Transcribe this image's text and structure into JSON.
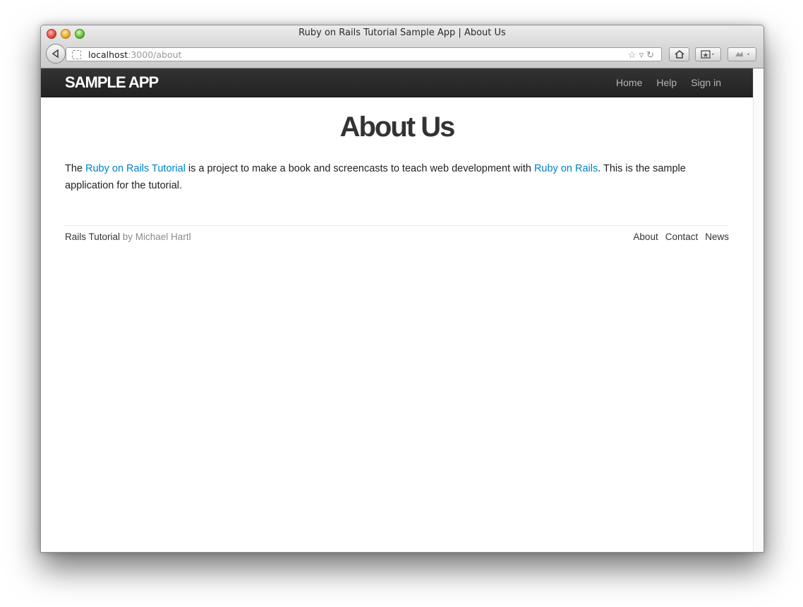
{
  "window": {
    "title": "Ruby on Rails Tutorial Sample App | About Us"
  },
  "address_bar": {
    "host": "localhost",
    "rest": ":3000/about"
  },
  "toolbar": {
    "icons": [
      "back-icon",
      "bookmark-star-icon",
      "reload-icon",
      "home-icon",
      "bookmarks-icon",
      "addon-icon"
    ]
  },
  "navbar": {
    "logo": "SAMPLE APP",
    "links": [
      "Home",
      "Help",
      "Sign in"
    ]
  },
  "page": {
    "heading": "About Us",
    "intro": {
      "p1": "The ",
      "link1": "Ruby on Rails Tutorial",
      "p2": " is a project to make a book and screencasts to teach web development with ",
      "link2": "Ruby on Rails",
      "p3": ". This is the sample application for the tutorial."
    }
  },
  "footer": {
    "brand": "Rails Tutorial",
    "by": " by Michael Hartl",
    "links": [
      "About",
      "Contact",
      "News"
    ]
  },
  "colors": {
    "navbar": "#222222",
    "link": "#0081c6",
    "text": "#222222"
  }
}
